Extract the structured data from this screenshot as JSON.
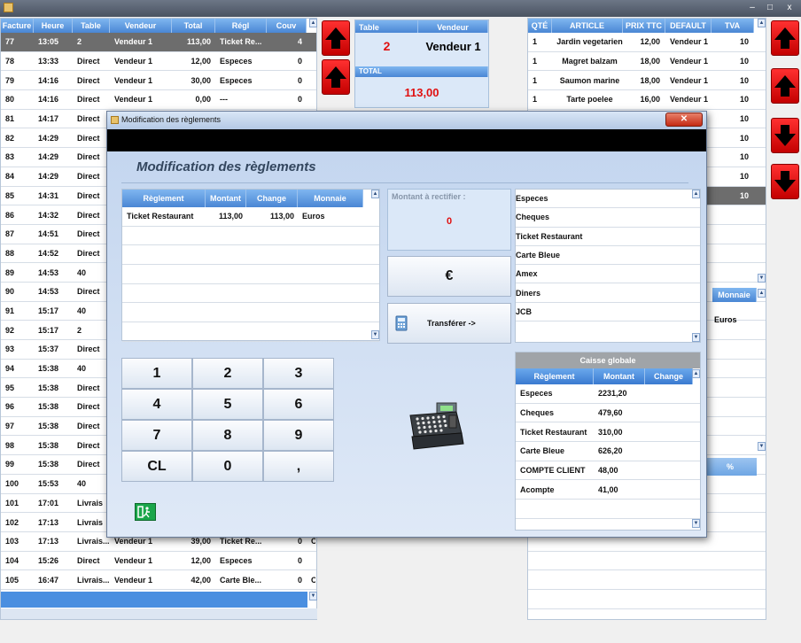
{
  "window": {
    "minimize": "–",
    "maximize": "□",
    "close": "x"
  },
  "invoices": {
    "headers": [
      "Facture",
      "Heure",
      "Table",
      "Vendeur",
      "Total",
      "Régl",
      "Couv"
    ],
    "rows": [
      [
        "77",
        "13:05",
        "2",
        "Vendeur 1",
        "113,00",
        "Ticket Re...",
        "4"
      ],
      [
        "78",
        "13:33",
        "Direct",
        "Vendeur 1",
        "12,00",
        "Especes",
        "0"
      ],
      [
        "79",
        "14:16",
        "Direct",
        "Vendeur 1",
        "30,00",
        "Especes",
        "0"
      ],
      [
        "80",
        "14:16",
        "Direct",
        "Vendeur 1",
        "0,00",
        "---",
        "0"
      ],
      [
        "81",
        "14:17",
        "Direct",
        "",
        "",
        "",
        ""
      ],
      [
        "82",
        "14:29",
        "Direct",
        "",
        "",
        "",
        ""
      ],
      [
        "83",
        "14:29",
        "Direct",
        "",
        "",
        "",
        ""
      ],
      [
        "84",
        "14:29",
        "Direct",
        "",
        "",
        "",
        ""
      ],
      [
        "85",
        "14:31",
        "Direct",
        "",
        "",
        "",
        ""
      ],
      [
        "86",
        "14:32",
        "Direct",
        "",
        "",
        "",
        ""
      ],
      [
        "87",
        "14:51",
        "Direct",
        "",
        "",
        "",
        ""
      ],
      [
        "88",
        "14:52",
        "Direct",
        "",
        "",
        "",
        ""
      ],
      [
        "89",
        "14:53",
        "40",
        "",
        "",
        "",
        ""
      ],
      [
        "90",
        "14:53",
        "Direct",
        "",
        "",
        "",
        ""
      ],
      [
        "91",
        "15:17",
        "40",
        "",
        "",
        "",
        ""
      ],
      [
        "92",
        "15:17",
        "2",
        "",
        "",
        "",
        ""
      ],
      [
        "93",
        "15:37",
        "Direct",
        "",
        "",
        "",
        ""
      ],
      [
        "94",
        "15:38",
        "40",
        "",
        "",
        "",
        ""
      ],
      [
        "95",
        "15:38",
        "Direct",
        "",
        "",
        "",
        ""
      ],
      [
        "96",
        "15:38",
        "Direct",
        "",
        "",
        "",
        ""
      ],
      [
        "97",
        "15:38",
        "Direct",
        "",
        "",
        "",
        ""
      ],
      [
        "98",
        "15:38",
        "Direct",
        "",
        "",
        "",
        ""
      ],
      [
        "99",
        "15:38",
        "Direct",
        "",
        "",
        "",
        ""
      ],
      [
        "100",
        "15:53",
        "40",
        "",
        "",
        "",
        ""
      ],
      [
        "101",
        "17:01",
        "Livrais",
        "",
        "",
        "",
        ""
      ],
      [
        "102",
        "17:13",
        "Livrais",
        "",
        "",
        "",
        ""
      ],
      [
        "103",
        "17:13",
        "Livrais...",
        "Vendeur 1",
        "39,00",
        "Ticket Re...",
        "0"
      ],
      [
        "104",
        "15:26",
        "Direct",
        "Vendeur 1",
        "12,00",
        "Especes",
        "0"
      ],
      [
        "105",
        "16:47",
        "Livrais...",
        "Vendeur 1",
        "42,00",
        "Carte Ble...",
        "0"
      ]
    ],
    "row103_extra": "Ch",
    "row105_extra": "Ch"
  },
  "order_header": {
    "table_label": "Table",
    "vendeur_label": "Vendeur",
    "table_value": "2",
    "vendeur_value": "Vendeur 1",
    "total_label": "TOTAL",
    "total_value": "113,00"
  },
  "articles": {
    "headers": [
      "QTÉ",
      "ARTICLE",
      "PRIX TTC",
      "DEFAULT",
      "TVA"
    ],
    "rows": [
      [
        "1",
        "Jardin vegetarien",
        "12,00",
        "Vendeur 1",
        "10"
      ],
      [
        "1",
        "Magret balzam",
        "18,00",
        "Vendeur 1",
        "10"
      ],
      [
        "1",
        "Saumon marine",
        "18,00",
        "Vendeur 1",
        "10"
      ],
      [
        "1",
        "Tarte poelee",
        "16,00",
        "Vendeur 1",
        "10"
      ],
      [
        "",
        "",
        "",
        "1",
        "10"
      ],
      [
        "",
        "",
        "",
        "1",
        "10"
      ],
      [
        "",
        "",
        "",
        "1",
        "10"
      ],
      [
        "",
        "",
        "",
        "1",
        "10"
      ],
      [
        "",
        "",
        "",
        "1",
        "10"
      ]
    ],
    "monnaie_header": "Monnaie",
    "monnaie_value": "Euros",
    "percent_header": "%"
  },
  "dialog": {
    "title": "Modification des règlements",
    "heading": "Modification des règlements",
    "payments": {
      "headers": [
        "Règlement",
        "Montant",
        "Change",
        "Monnaie"
      ],
      "rows": [
        [
          "Ticket Restaurant",
          "113,00",
          "113,00",
          "Euros"
        ]
      ]
    },
    "rectify_label": "Montant à rectifier :",
    "rectify_value": "0",
    "euro_button": "€",
    "transfer_button": "Transférer ->",
    "methods": [
      "Especes",
      "Cheques",
      "Ticket Restaurant",
      "Carte Bleue",
      "Amex",
      "Diners",
      "JCB"
    ],
    "keypad": [
      "1",
      "2",
      "3",
      "4",
      "5",
      "6",
      "7",
      "8",
      "9",
      "CL",
      "0",
      ","
    ],
    "caisse": {
      "title": "Caisse globale",
      "headers": [
        "Règlement",
        "Montant",
        "Change"
      ],
      "rows": [
        [
          "Especes",
          "2231,20"
        ],
        [
          "Cheques",
          "479,60"
        ],
        [
          "Ticket Restaurant",
          "310,00"
        ],
        [
          "Carte Bleue",
          "626,20"
        ],
        [
          "COMPTE CLIENT",
          "48,00"
        ],
        [
          "Acompte",
          "41,00"
        ]
      ]
    }
  },
  "colors": {
    "accent": "#4a86d4",
    "red": "#e01010",
    "selected_row": "#6d6d6d"
  }
}
